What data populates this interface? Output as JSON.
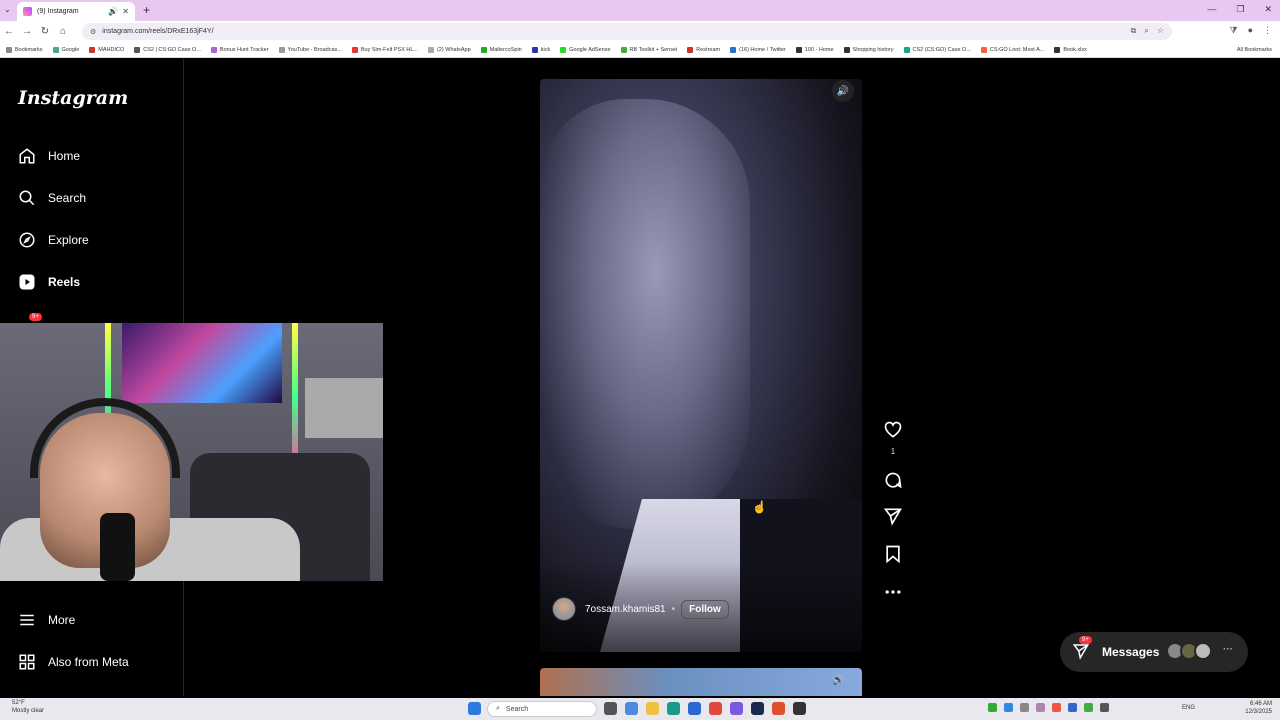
{
  "browser": {
    "tab_title": "(9) Instagram",
    "url": "instagram.com/reels/DRxE163jF4Y/",
    "bookmarks": [
      "Bookmarks",
      "Google",
      "MAHDICO",
      "CS2 | CS:GO Case O...",
      "Bonus Hunt Tracker",
      "YouTube - Broadcas...",
      "Buy Sim-Felt PSX HL...",
      "(2) WhatsApp",
      "MaltercoSpin",
      "kick",
      "Google AdSense",
      "RB Toolkit + Sensei",
      "Restream",
      "(16) Home / Twitter",
      "100 - Home",
      "Shopping history",
      "CS2 (CS:GO) Case O...",
      "CS:GO Loot: Most A...",
      "Book.xlsx"
    ],
    "all_bookmarks": "All Bookmarks",
    "colors": {
      "tab_strip": "#e8c8f0"
    }
  },
  "sidebar": {
    "logo": "Instagram",
    "items": [
      {
        "label": "Home",
        "icon": "home-icon"
      },
      {
        "label": "Search",
        "icon": "search-icon"
      },
      {
        "label": "Explore",
        "icon": "compass-icon"
      },
      {
        "label": "Reels",
        "icon": "reels-icon"
      }
    ],
    "notif_badge": "9+",
    "more_label": "More",
    "meta_label": "Also from Meta"
  },
  "reel": {
    "username": "7ossam.khamis81",
    "separator": "•",
    "follow_label": "Follow",
    "like_count": "1"
  },
  "messages": {
    "label": "Messages",
    "badge": "9+",
    "more": "···"
  },
  "taskbar": {
    "temperature": "52°F",
    "weather": "Mostly clear",
    "search_placeholder": "Search",
    "language": "ENG",
    "time": "6:46 AM",
    "date": "12/3/2025"
  }
}
